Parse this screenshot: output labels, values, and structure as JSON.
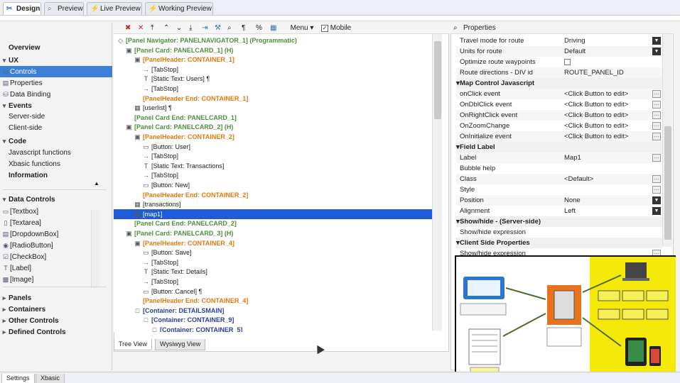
{
  "top_tabs": [
    {
      "label": "Design",
      "icon": "wrench-icon"
    },
    {
      "label": "Preview",
      "icon": "magnifier-icon"
    },
    {
      "label": "Live Preview",
      "icon": "lightning-icon"
    },
    {
      "label": "Working Preview",
      "icon": "lightning-icon"
    }
  ],
  "left_nav": [
    {
      "label": "Overview",
      "type": "header"
    },
    {
      "label": "UX",
      "type": "section"
    },
    {
      "label": "Controls",
      "type": "item",
      "selected": true
    },
    {
      "label": "Properties",
      "type": "item"
    },
    {
      "label": "Data Binding",
      "type": "item"
    },
    {
      "label": "Events",
      "type": "section"
    },
    {
      "label": "Server-side",
      "type": "item"
    },
    {
      "label": "Client-side",
      "type": "item"
    },
    {
      "label": "Code",
      "type": "section"
    },
    {
      "label": "Javascript functions",
      "type": "item"
    },
    {
      "label": "Xbasic functions",
      "type": "item"
    },
    {
      "label": "Information",
      "type": "header"
    },
    {
      "label": "Data Controls",
      "type": "section"
    },
    {
      "label": "[Textbox]",
      "type": "item"
    },
    {
      "label": "[Textarea]",
      "type": "item"
    },
    {
      "label": "[DropdownBox]",
      "type": "item"
    },
    {
      "label": "[RadioButton]",
      "type": "item"
    },
    {
      "label": "[CheckBox]",
      "type": "item"
    },
    {
      "label": "[Label]",
      "type": "item"
    },
    {
      "label": "[Image]",
      "type": "item"
    },
    {
      "label": "Panels",
      "type": "collapsed"
    },
    {
      "label": "Containers",
      "type": "collapsed"
    },
    {
      "label": "Other Controls",
      "type": "collapsed"
    },
    {
      "label": "Defined Controls",
      "type": "collapsed"
    }
  ],
  "toolbar": {
    "menu_label": "Menu",
    "mobile_label": "Mobile"
  },
  "tree": [
    {
      "text": "[Panel Navigator: PANELNAVIGATOR_1] (Programmatic)",
      "indent": 0,
      "cls": "gr",
      "icon": "◇"
    },
    {
      "text": "[Panel Card: PANELCARD_1]  (H)",
      "indent": 1,
      "cls": "gr",
      "icon": "▣"
    },
    {
      "text": "[PanelHeader: CONTAINER_1]",
      "indent": 2,
      "cls": "or",
      "icon": "▣"
    },
    {
      "text": "[TabStop]",
      "indent": 3,
      "cls": "bk",
      "icon": "→"
    },
    {
      "text": "[Static Text: Users] ¶",
      "indent": 3,
      "cls": "bk",
      "icon": "T"
    },
    {
      "text": "[TabStop]",
      "indent": 3,
      "cls": "bk",
      "icon": "→"
    },
    {
      "text": "[PanelHeader End: CONTAINER_1]",
      "indent": 2,
      "cls": "or",
      "icon": ""
    },
    {
      "text": "[userlist] ¶",
      "indent": 2,
      "cls": "bk",
      "icon": "▦"
    },
    {
      "text": "[Panel Card End: PANELCARD_1]",
      "indent": 1,
      "cls": "gr",
      "icon": ""
    },
    {
      "text": "[Panel Card: PANELCARD_2]  (H)",
      "indent": 1,
      "cls": "gr",
      "icon": "▣"
    },
    {
      "text": "[PanelHeader: CONTAINER_2]",
      "indent": 2,
      "cls": "or",
      "icon": "▣"
    },
    {
      "text": "[Button: User]",
      "indent": 3,
      "cls": "bk",
      "icon": "▭"
    },
    {
      "text": "[TabStop]",
      "indent": 3,
      "cls": "bk",
      "icon": "→"
    },
    {
      "text": "[Static Text: Transactions]",
      "indent": 3,
      "cls": "bk",
      "icon": "T"
    },
    {
      "text": "[TabStop]",
      "indent": 3,
      "cls": "bk",
      "icon": "→"
    },
    {
      "text": "[Button: New]",
      "indent": 3,
      "cls": "bk",
      "icon": "▭"
    },
    {
      "text": "[PanelHeader End: CONTAINER_2]",
      "indent": 2,
      "cls": "or",
      "icon": ""
    },
    {
      "text": "[transactions]",
      "indent": 2,
      "cls": "bk",
      "icon": "▦"
    },
    {
      "text": "[map1]",
      "indent": 2,
      "cls": "bk",
      "icon": "▩",
      "selected": true
    },
    {
      "text": "[Panel Card End: PANELCARD_2]",
      "indent": 1,
      "cls": "gr",
      "icon": ""
    },
    {
      "text": "[Panel Card: PANELCARD_3]  (H)",
      "indent": 1,
      "cls": "gr",
      "icon": "▣"
    },
    {
      "text": "[PanelHeader: CONTAINER_4]",
      "indent": 2,
      "cls": "or",
      "icon": "▣"
    },
    {
      "text": "[Button: Save]",
      "indent": 3,
      "cls": "bk",
      "icon": "▭"
    },
    {
      "text": "[TabStop]",
      "indent": 3,
      "cls": "bk",
      "icon": "→"
    },
    {
      "text": "[Static Text: Details]",
      "indent": 3,
      "cls": "bk",
      "icon": "T"
    },
    {
      "text": "[TabStop]",
      "indent": 3,
      "cls": "bk",
      "icon": "→"
    },
    {
      "text": "[Button: Cancel] ¶",
      "indent": 3,
      "cls": "bk",
      "icon": "▭"
    },
    {
      "text": "[PanelHeader End: CONTAINER_4]",
      "indent": 2,
      "cls": "or",
      "icon": ""
    },
    {
      "text": "[Container: DETAILSMAIN]",
      "indent": 2,
      "cls": "bl",
      "icon": "□"
    },
    {
      "text": "[Container: CONTAINER_9]",
      "indent": 3,
      "cls": "bl",
      "icon": "□"
    },
    {
      "text": "[Container: CONTAINER_5]",
      "indent": 4,
      "cls": "bl",
      "icon": "□"
    }
  ],
  "bottom_tabs": [
    "Tree View",
    "Wysiwyg View"
  ],
  "properties_title": "Properties",
  "properties": [
    {
      "key": "Travel mode for route",
      "value": "Driving",
      "ctl": "drop"
    },
    {
      "key": "Units for route",
      "value": "Default",
      "ctl": "drop"
    },
    {
      "key": "Optimize route waypoints",
      "value": "",
      "ctl": "check"
    },
    {
      "key": "Route directions - DIV id",
      "value": "ROUTE_PANEL_ID",
      "ctl": ""
    },
    {
      "key": "Map Control Javascript",
      "value": "",
      "ctl": "",
      "section": true
    },
    {
      "key": "onClick event",
      "value": "<Click Button to edit>",
      "ctl": "btn"
    },
    {
      "key": "OnDblClick event",
      "value": "<Click Button to edit>",
      "ctl": "btn"
    },
    {
      "key": "OnRightClick event",
      "value": "<Click Button to edit>",
      "ctl": "btn"
    },
    {
      "key": "OnZoomChange",
      "value": "<Click Button to edit>",
      "ctl": "btn"
    },
    {
      "key": "OnInitialize event",
      "value": "<Click Button to edit>",
      "ctl": "btn"
    },
    {
      "key": "Field Label",
      "value": "",
      "ctl": "",
      "section": true
    },
    {
      "key": "Label",
      "value": "Map1",
      "ctl": "btn"
    },
    {
      "key": "Bubble help",
      "value": "",
      "ctl": ""
    },
    {
      "key": "Class",
      "value": "<Default>",
      "ctl": "btn"
    },
    {
      "key": "Style",
      "value": "",
      "ctl": "btn"
    },
    {
      "key": "Position",
      "value": "None",
      "ctl": "drop"
    },
    {
      "key": "Alignment",
      "value": "Left",
      "ctl": "drop"
    },
    {
      "key": "Show/hide - (Server-side)",
      "value": "",
      "ctl": "",
      "section": true
    },
    {
      "key": "Show/hide expression",
      "value": "",
      "ctl": ""
    },
    {
      "key": "Client Side Properties",
      "value": "",
      "ctl": "",
      "section": true
    },
    {
      "key": "Show/hide expression",
      "value": "",
      "ctl": "btn"
    }
  ],
  "footer_tabs": [
    "Settings",
    "Xbasic"
  ],
  "colors": {
    "selection": "#1f5bd6",
    "accent": "#3d7fd6",
    "overlay_yellow": "#f5e90a",
    "device_orange": "#e8731c"
  }
}
